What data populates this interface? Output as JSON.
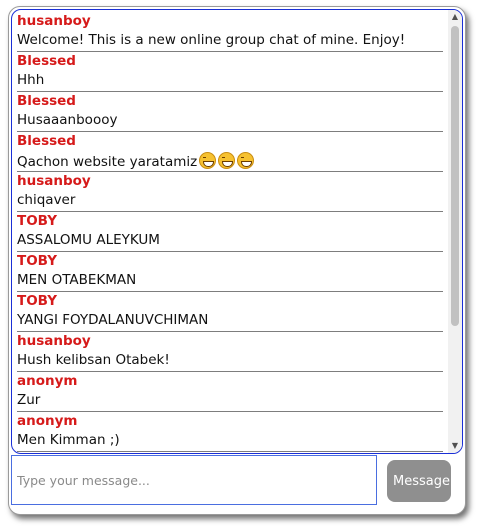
{
  "messages": [
    {
      "author": "husanboy",
      "text": "Welcome! This is a new online group chat of mine. Enjoy!"
    },
    {
      "author": "Blessed",
      "text": "Hhh"
    },
    {
      "author": "Blessed",
      "text": "Husaaanboooy"
    },
    {
      "author": "Blessed",
      "text": "Qachon website yaratamiz",
      "emoji": [
        "grinning-squinting-face",
        "grinning-squinting-face",
        "grinning-squinting-face"
      ]
    },
    {
      "author": "husanboy",
      "text": "chiqaver"
    },
    {
      "author": "TOBY",
      "text": "ASSALOMU ALEYKUM"
    },
    {
      "author": "TOBY",
      "text": "MEN OTABEKMAN"
    },
    {
      "author": "TOBY",
      "text": "YANGI FOYDALANUVCHIMAN"
    },
    {
      "author": "husanboy",
      "text": "Hush kelibsan Otabek!"
    },
    {
      "author": "anonym",
      "text": "Zur"
    },
    {
      "author": "anonym",
      "text": "Men Kimman ;)"
    }
  ],
  "composer": {
    "placeholder": "Type your message...",
    "send_label": "Message"
  },
  "colors": {
    "author": "#d61a1a",
    "panel_border": "#1a2fd6",
    "send_button": "#8f8f8f"
  }
}
